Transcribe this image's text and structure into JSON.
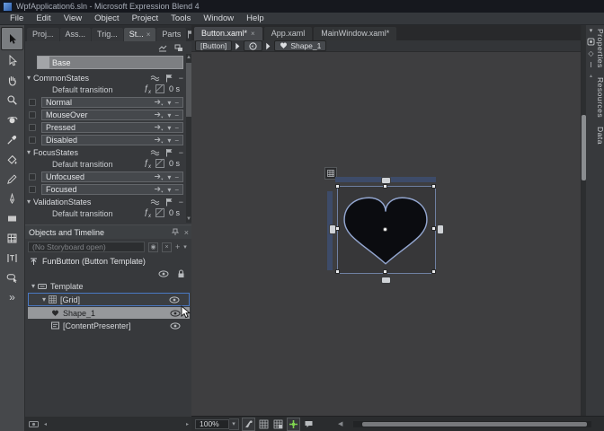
{
  "window": {
    "title": "WpfApplication6.sln - Microsoft Expression Blend 4"
  },
  "menu": {
    "items": [
      "File",
      "Edit",
      "View",
      "Object",
      "Project",
      "Tools",
      "Window",
      "Help"
    ]
  },
  "toolbox": {
    "tools": [
      {
        "name": "selection",
        "active": true
      },
      {
        "name": "direct-selection",
        "active": false
      },
      {
        "name": "pan",
        "active": false
      },
      {
        "name": "zoom",
        "active": false
      },
      {
        "name": "camera-orbit",
        "active": false
      },
      {
        "name": "eyedropper",
        "active": false
      },
      {
        "name": "paint-bucket",
        "active": false
      },
      {
        "name": "pencil",
        "active": false
      },
      {
        "name": "pen",
        "active": false
      },
      {
        "name": "rectangle",
        "active": false
      },
      {
        "name": "grid",
        "active": false
      },
      {
        "name": "text",
        "active": false
      },
      {
        "name": "button",
        "active": false
      },
      {
        "name": "assets",
        "active": false
      }
    ]
  },
  "panel_tabs": {
    "items": [
      {
        "label": "Proj...",
        "active": false,
        "closable": false
      },
      {
        "label": "Ass...",
        "active": false,
        "closable": false
      },
      {
        "label": "Trig...",
        "active": false,
        "closable": false
      },
      {
        "label": "St...",
        "active": true,
        "closable": true
      },
      {
        "label": "Parts",
        "active": false,
        "closable": false
      }
    ]
  },
  "states_panel": {
    "base_label": "Base",
    "groups": [
      {
        "name": "CommonStates",
        "transition_label": "Default transition",
        "transition_time": "0 s",
        "states": [
          "Normal",
          "MouseOver",
          "Pressed",
          "Disabled"
        ]
      },
      {
        "name": "FocusStates",
        "transition_label": "Default transition",
        "transition_time": "0 s",
        "states": [
          "Unfocused",
          "Focused"
        ]
      },
      {
        "name": "ValidationStates",
        "transition_label": "Default transition",
        "transition_time": "0 s",
        "states": []
      }
    ]
  },
  "objects_panel": {
    "title": "Objects and Timeline",
    "storyboard_placeholder": "(No Storyboard open)",
    "scope_label": "FunButton (Button Template)",
    "tree": [
      {
        "label": "Template",
        "icon": "template-node",
        "indent": 0,
        "caret": true,
        "selected": "none",
        "eye": false
      },
      {
        "label": "[Grid]",
        "icon": "grid-node",
        "indent": 1,
        "caret": true,
        "selected": "outline",
        "eye": true
      },
      {
        "label": "Shape_1",
        "icon": "shape-node",
        "indent": 2,
        "caret": false,
        "selected": "highlight",
        "eye": true
      },
      {
        "label": "[ContentPresenter]",
        "icon": "content-node",
        "indent": 2,
        "caret": false,
        "selected": "none",
        "eye": true
      }
    ]
  },
  "document_tabs": {
    "items": [
      {
        "label": "Button.xaml*",
        "active": true,
        "closable": true
      },
      {
        "label": "App.xaml",
        "active": false,
        "closable": false
      },
      {
        "label": "MainWindow.xaml*",
        "active": false,
        "closable": false
      }
    ]
  },
  "breadcrumb": {
    "items": [
      {
        "label": "[Button]",
        "icon": ""
      },
      {
        "label": "",
        "icon": "style-scope"
      },
      {
        "label": "Shape_1",
        "icon": "shape-node"
      }
    ]
  },
  "artboard": {
    "zoom_level": "100%"
  },
  "right_strip": {
    "tabs": [
      "Properties",
      "Resources",
      "Data"
    ]
  },
  "colors": {
    "selection_blue": "#4a79c4",
    "snap_green": "#7fd34f",
    "heart_stroke": "#93a6d0",
    "heart_fill": "#0b0c10",
    "grid_rail": "#3d4b69"
  }
}
